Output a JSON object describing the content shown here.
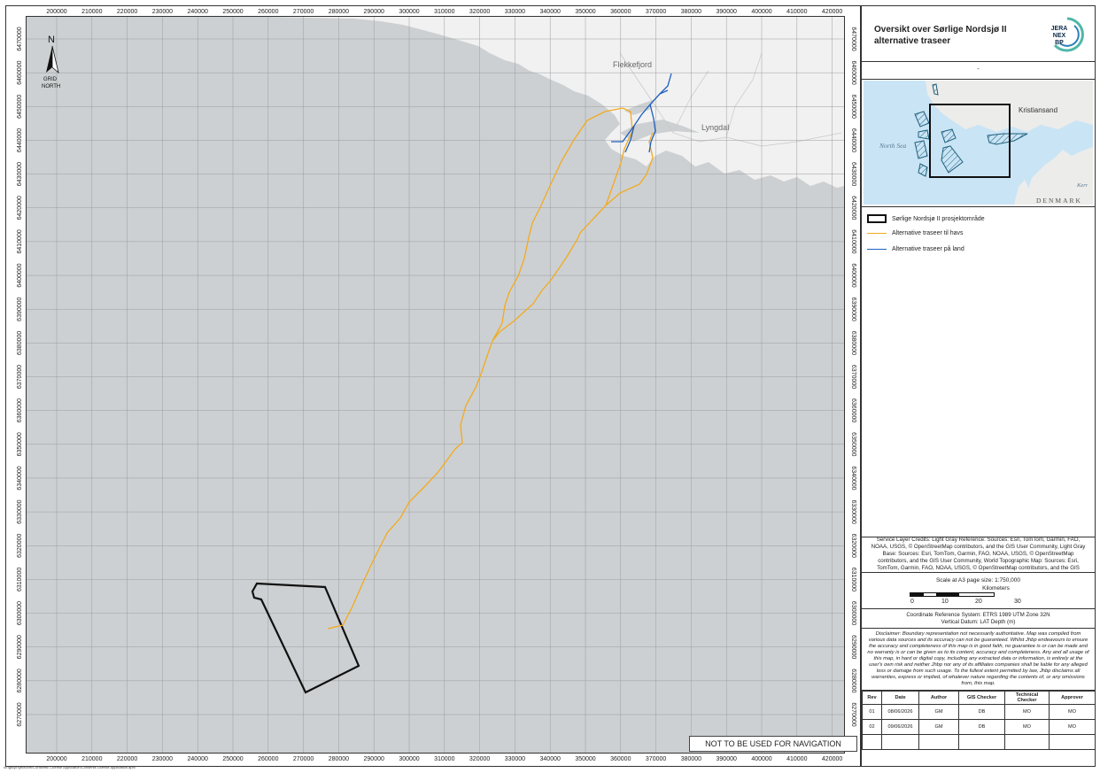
{
  "map": {
    "x_ticks": [
      "200000",
      "210000",
      "220000",
      "230000",
      "240000",
      "250000",
      "260000",
      "270000",
      "280000",
      "290000",
      "300000",
      "310000",
      "320000",
      "330000",
      "340000",
      "350000",
      "360000",
      "370000",
      "380000",
      "390000",
      "400000",
      "410000",
      "420000"
    ],
    "y_ticks": [
      "6470000",
      "6460000",
      "6450000",
      "6440000",
      "6430000",
      "6420000",
      "6410000",
      "6400000",
      "6390000",
      "6380000",
      "6370000",
      "6360000",
      "6350000",
      "6340000",
      "6330000",
      "6320000",
      "6310000",
      "6300000",
      "6290000",
      "6280000",
      "6270000"
    ],
    "place_labels": [
      "Flekkefjord",
      "Lyngdal"
    ],
    "north_arrow": {
      "letter": "N",
      "line1": "GRID",
      "line2": "NORTH"
    },
    "nav_note": "NOT TO BE USED FOR NAVIGATION",
    "file_path": "W:\\gis\\project\\orth\\Consents\\ License Application\\Consents License Application.aprx",
    "colors": {
      "sea": "#cdd0d2",
      "land": "#f1f1f1",
      "offshore_route": "#f2aa1f",
      "onshore_route": "#1f5fbf",
      "project_area": "#111111"
    }
  },
  "panel": {
    "title": "Oversikt over Sørlige Nordsjø II alternative traseer",
    "logo_text": [
      "JERA",
      "NEX",
      "BP"
    ],
    "subtitle": "-",
    "inset_labels": {
      "city": "Kristiansand",
      "sea": "North Sea",
      "country": "DENMARK",
      "partial": "Kerr"
    },
    "legend": [
      {
        "label": "Sørlige Nordsjø II prosjektområde"
      },
      {
        "label": "Alternative traseer til havs"
      },
      {
        "label": "Alternative traseer på land"
      }
    ],
    "credits": "Service Layer Credits: Light Gray Reference: Sources: Esri, TomTom, Garmin, FAO, NOAA, USGS, © OpenStreetMap contributors, and the GIS User Community, Light Gray Base: Sources: Esri, TomTom, Garmin, FAO, NOAA, USGS, © OpenStreetMap contributors, and the GIS User Community, World Topographic Map: Sources: Esri, TomTom, Garmin, FAO, NOAA, USGS, © OpenStreetMap contributors, and the GIS",
    "scale": {
      "text": "Scale at A3 page size:   1:750,000",
      "unit": "Kilometers",
      "ticks": [
        "0",
        "10",
        "20",
        "30"
      ]
    },
    "crs": {
      "line1": "Coordinate Reference System: ETRS 1989 UTM Zone 32N",
      "line2": "Vertical Datum: LAT Depth (m)"
    },
    "disclaimer": "Disclaimer: Boundary representation not necessarily authoritative. Map was compiled from various data sources and its accuracy can not be guaranteed. Whilst Jhbp endeavours to ensure the accuracy and completeness of this map is in good faith, no guarantee is or can be made and no warranty is or can be given as to its content, accuracy and completeness. Any and all usage of this map, in hard or digital copy, including any extracted data or information, is entirely at the user's own risk and neither Jhbp nor any of its affiliates companies shall be liable for any alleged loss or damage from such usage. To the fullest extent permitted by law, Jhbp disclaims all warranties, express or implied, of whatever nature regarding the contents of, or any omissions from, this map.",
    "revisions": {
      "headers": [
        "Rev",
        "Date",
        "Author",
        "GIS Checker",
        "Technical Checker",
        "Approver"
      ],
      "rows": [
        [
          "01",
          "08/06/2026",
          "GM",
          "DB",
          "MO",
          "MO"
        ],
        [
          "02",
          "09/06/2026",
          "GM",
          "DB",
          "MO",
          "MO"
        ]
      ]
    }
  }
}
